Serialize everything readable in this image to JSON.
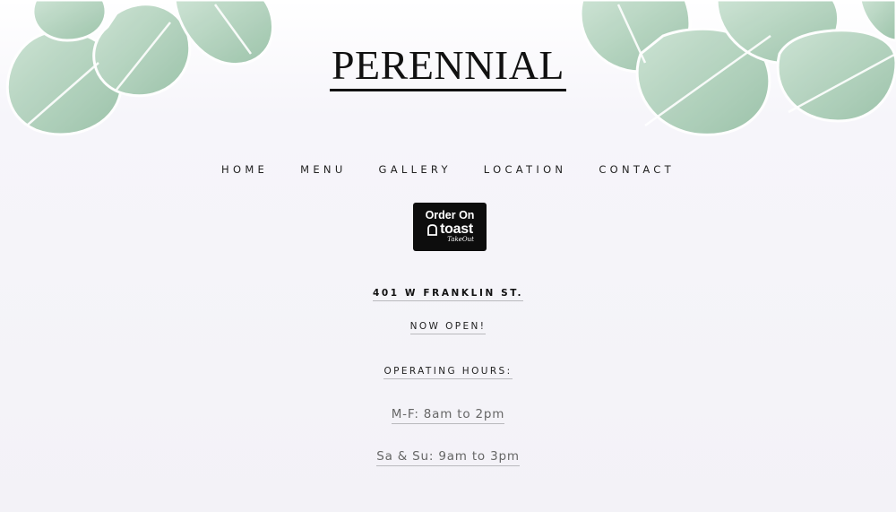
{
  "brand": {
    "title": "PERENNIAL"
  },
  "nav": {
    "items": [
      {
        "label": "HOME"
      },
      {
        "label": "MENU"
      },
      {
        "label": "GALLERY"
      },
      {
        "label": "LOCATION"
      },
      {
        "label": "CONTACT"
      }
    ]
  },
  "order_button": {
    "line1": "Order On",
    "brand": "toast",
    "sub": "TakeOut"
  },
  "info": {
    "address": "401 W FRANKLIN ST.",
    "status": "NOW OPEN!",
    "hours_heading": "OPERATING HOURS:",
    "hours_weekday": "M-F: 8am to 2pm",
    "hours_weekend": "Sa & Su: 9am to 3pm"
  },
  "colors": {
    "leaf": "#a9cdb6",
    "leaf_dark": "#86b597",
    "text": "#1f1f1f",
    "muted": "#666666"
  }
}
